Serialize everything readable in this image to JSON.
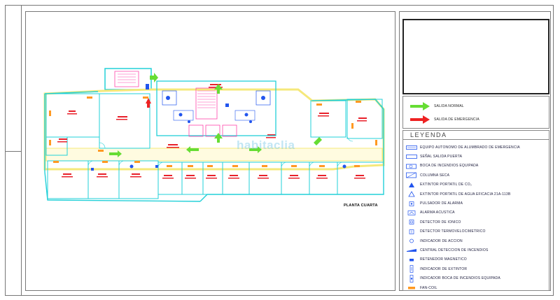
{
  "drawing": {
    "plan_caption": "PLANTA CUARTA",
    "watermark": "habitaclia"
  },
  "arrows": [
    {
      "label": "SALIDA NORMAL",
      "color": "#66dd33"
    },
    {
      "label": "SALIDA DE EMERGENCIA",
      "color": "#ee2222"
    }
  ],
  "legend": {
    "title": "LEYENDA",
    "items": [
      {
        "icon": "emergency-light-icon",
        "label": "EQUIPO AUTONOMO DE ALUMBRADO DE EMERGENCIA"
      },
      {
        "icon": "exit-sign-icon",
        "label": "SEÑAL SALIDA PUERTA"
      },
      {
        "icon": "fire-hose-icon",
        "label": "BOCA DE INCENDIOS EQUIPADA"
      },
      {
        "icon": "dry-riser-icon",
        "label": "COLUMNA SECA"
      },
      {
        "icon": "co2-extinguisher-icon",
        "label": "EXTINTOR PORTATIL DE CO₂"
      },
      {
        "icon": "water-extinguisher-icon",
        "label": "EXTINTOR PORTATIL DE AGUA EFICACIA 21A-113B"
      },
      {
        "icon": "alarm-button-icon",
        "label": "PULSADOR DE ALARMA"
      },
      {
        "icon": "acoustic-alarm-icon",
        "label": "ALARMA ACUSTICA"
      },
      {
        "icon": "ionic-detector-icon",
        "label": "DETECTOR DE IONICO"
      },
      {
        "icon": "thermovelocimetric-detector-icon",
        "label": "DETECTOR TERMOVELOCIMETRICO"
      },
      {
        "icon": "action-indicator-icon",
        "label": "INDICADOR DE ACCION"
      },
      {
        "icon": "fire-control-panel-icon",
        "label": "CENTRAL DETECCION DE INCENDIOS"
      },
      {
        "icon": "magnetic-holder-icon",
        "label": "RETENEDOR MAGNETICO"
      },
      {
        "icon": "extinguisher-indicator-icon",
        "label": "INDICADOR DE EXTINTOR"
      },
      {
        "icon": "hose-indicator-icon",
        "label": "INDICADOR BOCA DE INCENDIOS EQUIPADA"
      },
      {
        "icon": "fan-coil-icon",
        "label": "FAN-COIL"
      }
    ]
  },
  "colors": {
    "wall": "#22d0d8",
    "corridor": "#f5e87a",
    "label_red": "#e8202a",
    "stair_magenta": "#ff44aa",
    "device_blue": "#2255ee",
    "fan_coil_orange": "#ff9922"
  }
}
